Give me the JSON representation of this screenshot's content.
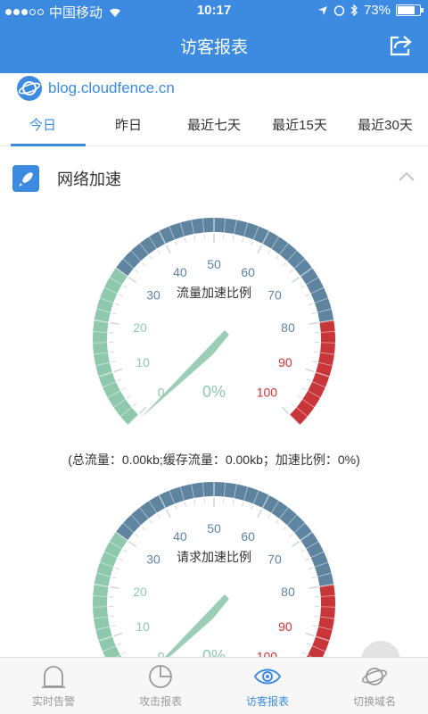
{
  "status_bar": {
    "carrier": "中国移动",
    "time": "10:17",
    "battery": "73%"
  },
  "nav": {
    "title": "访客报表"
  },
  "site": {
    "domain": "blog.cloudfence.cn"
  },
  "tabs": [
    {
      "label": "今日",
      "active": true
    },
    {
      "label": "昨日",
      "active": false
    },
    {
      "label": "最近七天",
      "active": false
    },
    {
      "label": "最近15天",
      "active": false
    },
    {
      "label": "最近30天",
      "active": false
    }
  ],
  "section": {
    "title": "网络加速"
  },
  "gauges": [
    {
      "label": "流量加速比例",
      "value_text": "0%",
      "value": 0,
      "ticks": [
        "0",
        "10",
        "20",
        "30",
        "40",
        "50",
        "60",
        "70",
        "80",
        "90",
        "100"
      ]
    },
    {
      "label": "请求加速比例",
      "value_text": "0%",
      "value": 0,
      "ticks": [
        "0",
        "10",
        "20",
        "30",
        "40",
        "50",
        "60",
        "70",
        "80",
        "90",
        "100"
      ]
    }
  ],
  "summary": "(总流量：0.00kb;缓存流量：0.00kb；加速比例：0%)",
  "tabbar": [
    {
      "label": "实时告警",
      "icon": "alarm-bell-icon",
      "active": false
    },
    {
      "label": "攻击报表",
      "icon": "pie-chart-icon",
      "active": false
    },
    {
      "label": "访客报表",
      "icon": "eye-icon",
      "active": true
    },
    {
      "label": "切换域名",
      "icon": "planet-icon",
      "active": false
    }
  ],
  "colors": {
    "primary": "#3c8be0",
    "gauge_green": "#8fc9ad",
    "gauge_blue": "#5f84a0",
    "gauge_red": "#c8363a"
  }
}
